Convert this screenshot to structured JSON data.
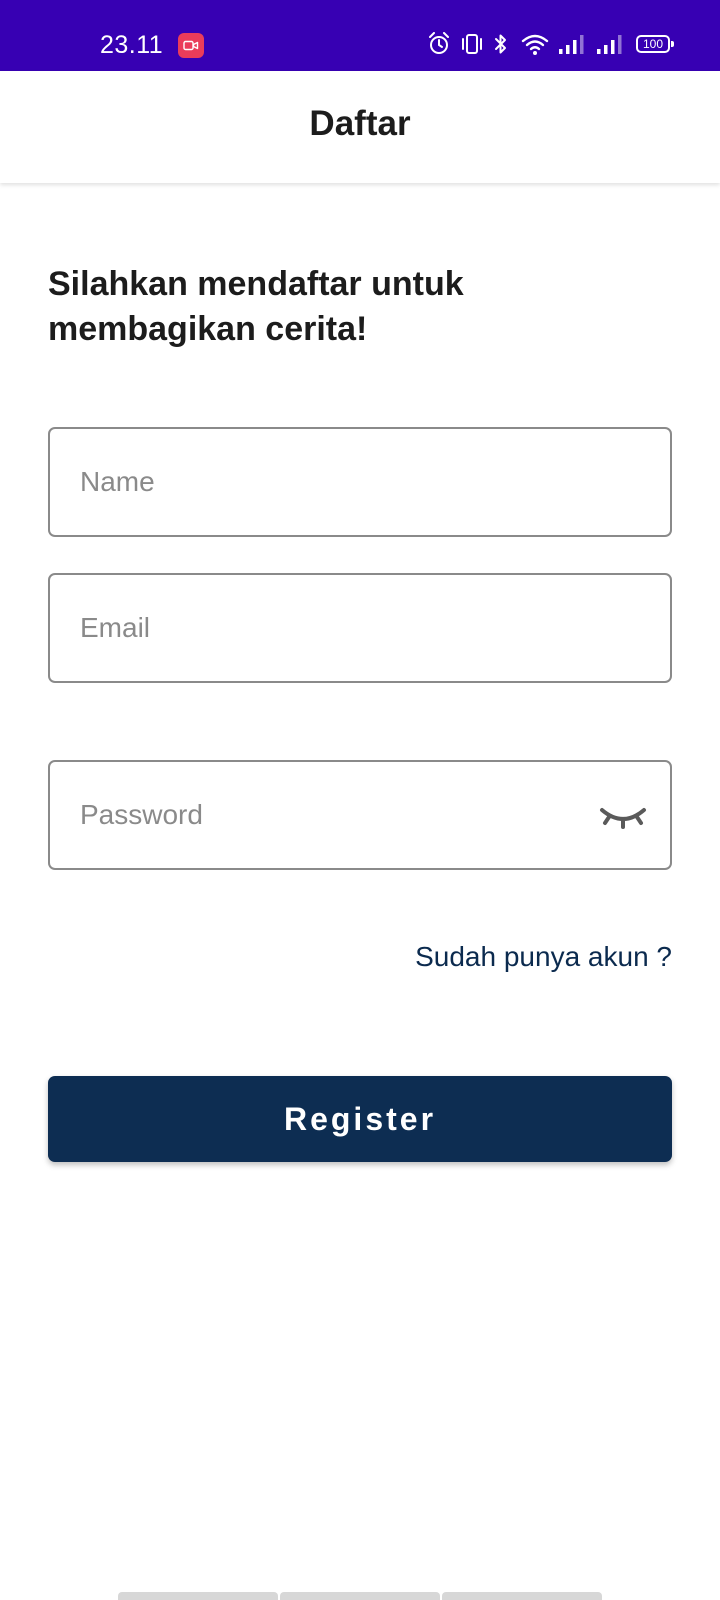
{
  "status_bar": {
    "time": "23.11",
    "battery": "100",
    "background": "#3700b3",
    "icons": [
      "screen-record-icon",
      "alarm-icon",
      "vibrate-icon",
      "bluetooth-icon",
      "wifi-icon",
      "signal-1-icon",
      "signal-2-icon",
      "battery-icon"
    ]
  },
  "app_bar": {
    "title": "Daftar"
  },
  "form": {
    "heading": "Silahkan mendaftar untuk membagikan cerita!",
    "name_placeholder": "Name",
    "email_placeholder": "Email",
    "password_placeholder": "Password",
    "password_toggle_icon": "eye-closed-icon",
    "login_link": "Sudah punya akun ?",
    "register_label": "Register"
  },
  "colors": {
    "primary": "#0d2d52",
    "link": "#0b2a4e",
    "field_border": "#8a8a8a",
    "status_bar": "#3700b3"
  }
}
